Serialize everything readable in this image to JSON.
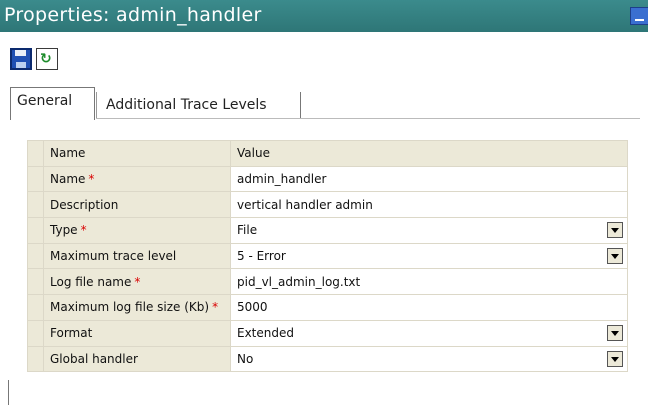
{
  "window": {
    "title": "Properties: admin_handler"
  },
  "toolbar": {
    "save_icon": "floppy-disk",
    "refresh_icon": "refresh"
  },
  "tabs": [
    {
      "label": "General",
      "active": true
    },
    {
      "label": "Additional Trace Levels",
      "active": false
    }
  ],
  "grid": {
    "header": {
      "name": "Name",
      "value": "Value"
    },
    "rows": [
      {
        "label": "Name",
        "required": "*",
        "value": "admin_handler"
      },
      {
        "label": "Description",
        "value": "vertical handler admin"
      },
      {
        "label": "Type",
        "required": "*",
        "value": "File"
      },
      {
        "label": "Maximum trace level",
        "value": "5 - Error"
      },
      {
        "label": "Log file name",
        "required": "*",
        "value": "pid_vl_admin_log.txt"
      },
      {
        "label": "Maximum log file size (Kb)",
        "required": "*",
        "value": "5000"
      },
      {
        "label": "Format",
        "value": "Extended"
      },
      {
        "label": "Global handler",
        "value": "No"
      }
    ]
  },
  "colors": {
    "titlebar": "#2e7677",
    "grid_gutter": "#ece9d8",
    "required": "#d90000"
  }
}
